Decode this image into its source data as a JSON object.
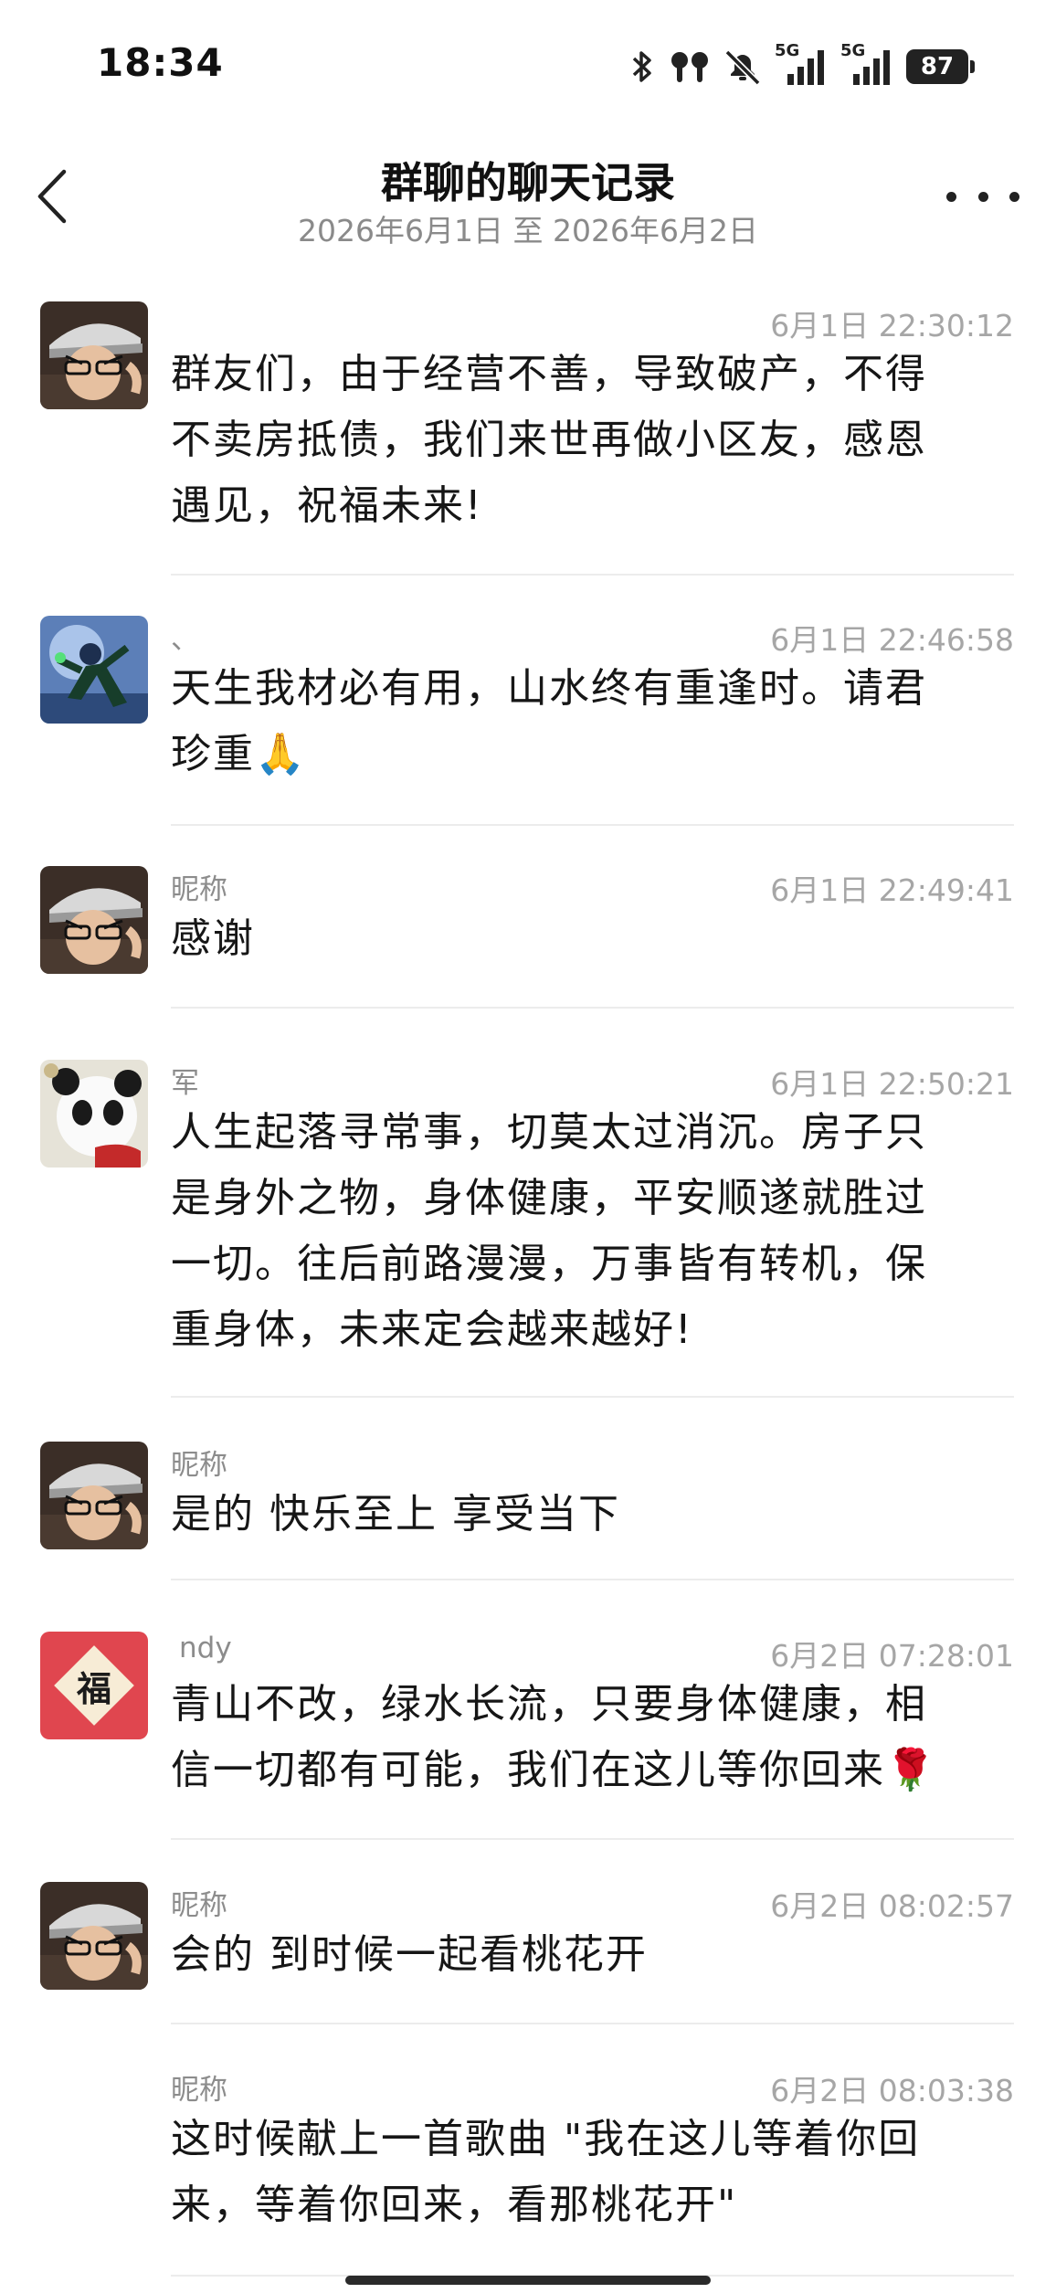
{
  "status_bar": {
    "time": "18:34",
    "network1": "5G",
    "network2": "5G",
    "battery": "87",
    "icons": [
      "bluetooth-icon",
      "earbuds-icon",
      "mute-icon",
      "signal-icon",
      "signal-icon",
      "battery-icon"
    ]
  },
  "header": {
    "title": "群聊的聊天记录",
    "subtitle": "2026年6月1日 至 2026年6月2日",
    "back_icon": "chevron-left-icon",
    "more_icon": "more-horizontal-icon"
  },
  "messages": [
    {
      "sender": "",
      "time": "6月1日 22:30:12",
      "lines": [
        "群友们，由于经营不善，导致破产，不得",
        "不卖房抵债，我们来世再做小区友，感恩",
        "遇见，祝福未来!"
      ],
      "avatar": "anime-man-cap-avatar"
    },
    {
      "sender": "、",
      "time": "6月1日 22:46:58",
      "lines": [
        "天生我材必有用，山水终有重逢时。请君",
        "珍重🙏"
      ],
      "avatar": "superhero-avatar"
    },
    {
      "sender": "昵称",
      "time": "6月1日 22:49:41",
      "lines": [
        "感谢"
      ],
      "avatar": "anime-man-cap-avatar"
    },
    {
      "sender": "军",
      "time": "6月1日 22:50:21",
      "lines": [
        "人生起落寻常事，切莫太过消沉。房子只",
        "是身外之物，身体健康，平安顺遂就胜过",
        "一切。往后前路漫漫，万事皆有转机，保",
        "重身体，未来定会越来越好!"
      ],
      "avatar": "panda-avatar"
    },
    {
      "sender": "昵称",
      "time": "",
      "lines": [
        "是的 快乐至上 享受当下"
      ],
      "avatar": "anime-man-cap-avatar"
    },
    {
      "sender": "ndy",
      "time": "6月2日 07:28:01",
      "lines": [
        "青山不改，绿水长流，只要身体健康，相",
        "信一切都有可能，我们在这儿等你回来🌹"
      ],
      "avatar": "fu-character-avatar",
      "fu": "福"
    },
    {
      "sender": "昵称",
      "time": "6月2日 08:02:57",
      "lines": [
        "会的 到时候一起看桃花开"
      ],
      "avatar": "anime-man-cap-avatar"
    },
    {
      "sender": "昵称",
      "time": "6月2日 08:03:38",
      "lines": [
        "这时候献上一首歌曲 \"我在这儿等着你回",
        "来，等着你回来，看那桃花开\""
      ],
      "avatar": ""
    }
  ]
}
